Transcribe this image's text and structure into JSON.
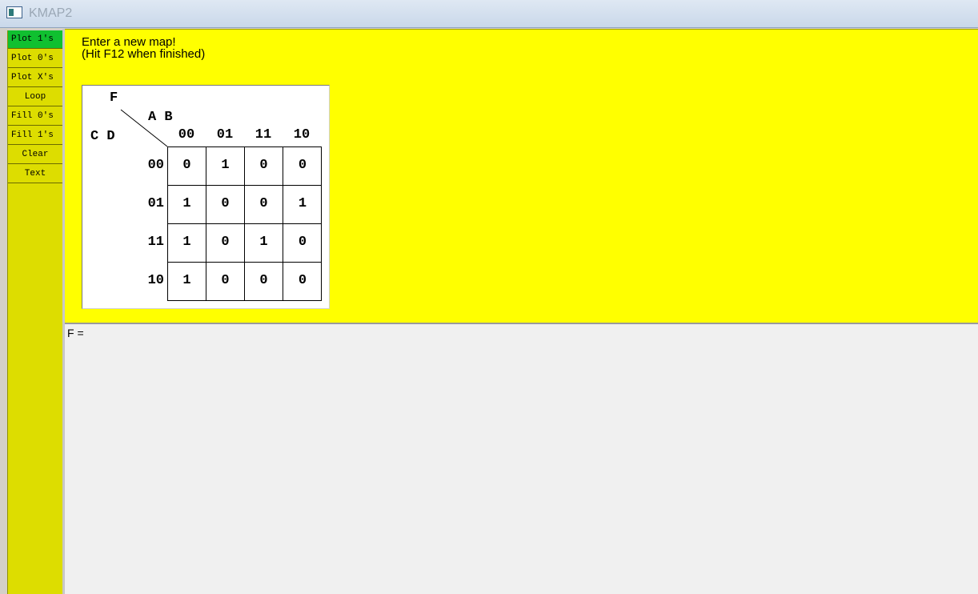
{
  "window": {
    "title": "KMAP2"
  },
  "sidebar": {
    "items": [
      {
        "label": "Plot 1's",
        "active": true
      },
      {
        "label": "Plot 0's",
        "active": false
      },
      {
        "label": "Plot X's",
        "active": false
      },
      {
        "label": "Loop",
        "active": false
      },
      {
        "label": "Fill 0's",
        "active": false
      },
      {
        "label": "Fill 1's",
        "active": false
      },
      {
        "label": "Clear",
        "active": false
      },
      {
        "label": "Text",
        "active": false
      }
    ]
  },
  "instructions": {
    "line1": "Enter a new map!",
    "line2": "(Hit F12 when finished)"
  },
  "kmap": {
    "function_name": "F",
    "col_vars": "A B",
    "row_vars": "C D",
    "col_headers": [
      "00",
      "01",
      "11",
      "10"
    ],
    "row_headers": [
      "00",
      "01",
      "11",
      "10"
    ],
    "cells": [
      [
        "0",
        "1",
        "0",
        "0"
      ],
      [
        "1",
        "0",
        "0",
        "1"
      ],
      [
        "1",
        "0",
        "1",
        "0"
      ],
      [
        "1",
        "0",
        "0",
        "0"
      ]
    ]
  },
  "expression": {
    "label": "F ="
  },
  "colors": {
    "map_background": "#ffff00",
    "sidebar_background": "#dddd00",
    "active_button": "#10c030",
    "expression_background": "#f0f0f0"
  }
}
